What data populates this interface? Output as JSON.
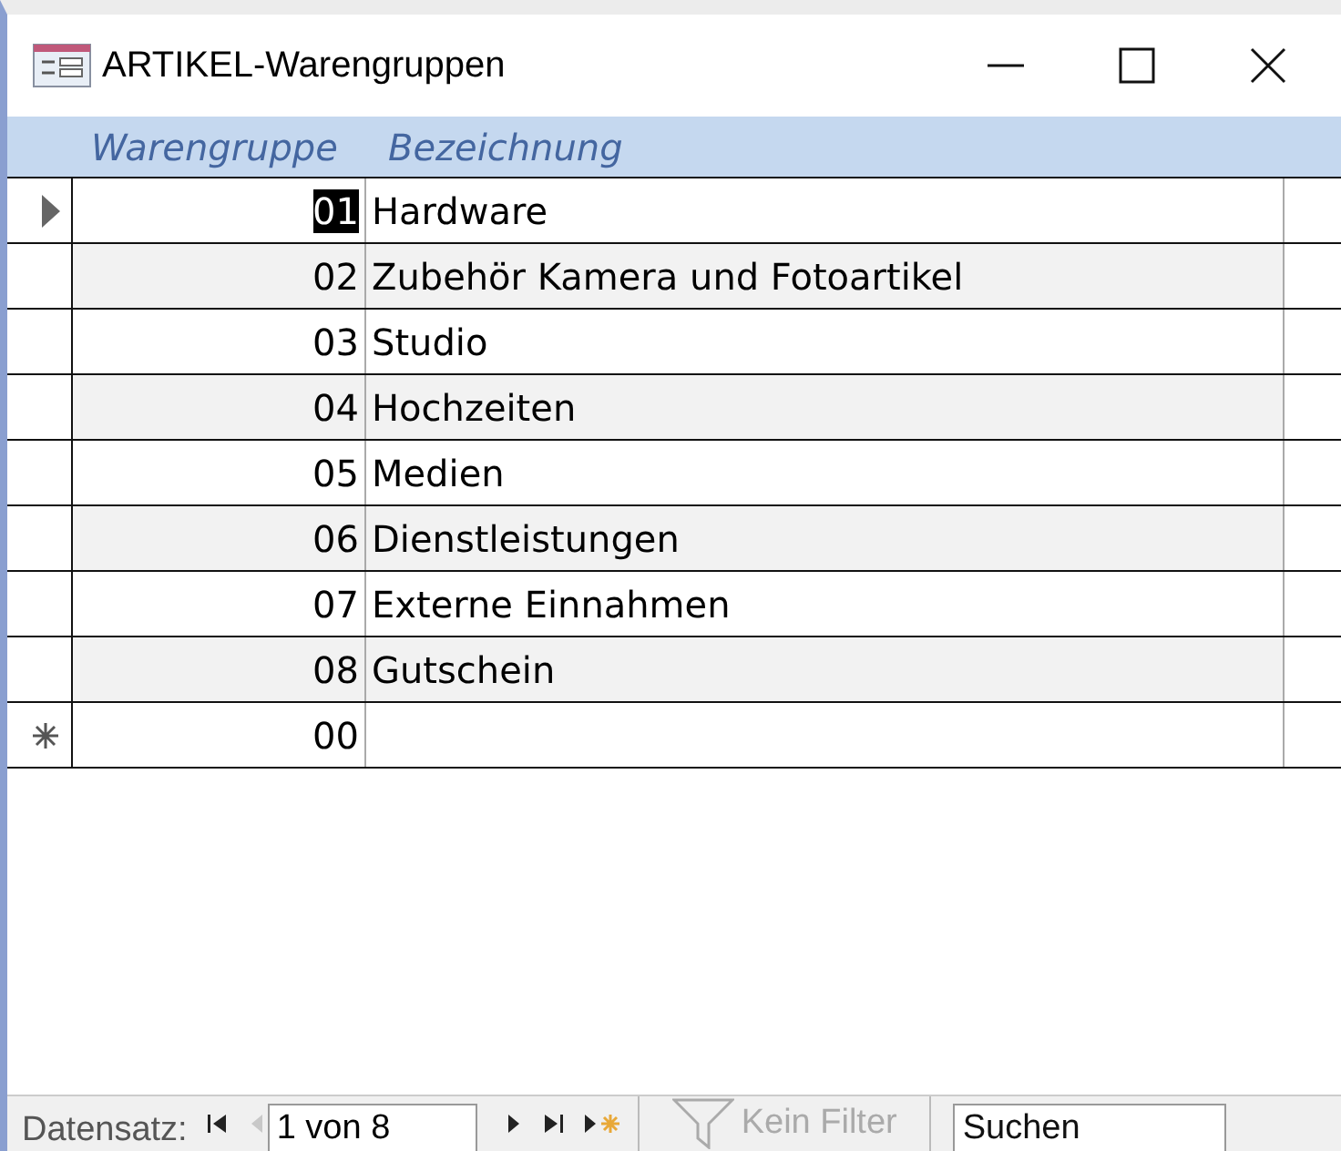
{
  "window": {
    "title": "ARTIKEL-Warengruppen"
  },
  "columns": [
    "Warengruppe",
    "Bezeichnung"
  ],
  "rows": [
    {
      "warengruppe": "01",
      "bezeichnung": "Hardware",
      "selected": true
    },
    {
      "warengruppe": "02",
      "bezeichnung": "Zubehör Kamera und Fotoartikel",
      "selected": false
    },
    {
      "warengruppe": "03",
      "bezeichnung": "Studio",
      "selected": false
    },
    {
      "warengruppe": "04",
      "bezeichnung": "Hochzeiten",
      "selected": false
    },
    {
      "warengruppe": "05",
      "bezeichnung": "Medien",
      "selected": false
    },
    {
      "warengruppe": "06",
      "bezeichnung": "Dienstleistungen",
      "selected": false
    },
    {
      "warengruppe": "07",
      "bezeichnung": "Externe Einnahmen",
      "selected": false
    },
    {
      "warengruppe": "08",
      "bezeichnung": "Gutschein",
      "selected": false
    }
  ],
  "new_row": {
    "warengruppe": "00"
  },
  "navigation": {
    "label": "Datensatz:",
    "position": "1 von 8",
    "buttons": [
      {
        "kind": "first",
        "disabled": false
      },
      {
        "kind": "prev",
        "disabled": true
      },
      {
        "kind": "next",
        "disabled": false
      },
      {
        "kind": "last",
        "disabled": false
      },
      {
        "kind": "new",
        "disabled": false
      }
    ],
    "filter": {
      "label": "Kein Filter",
      "disabled": true
    },
    "search": {
      "placeholder": "Suchen"
    }
  }
}
